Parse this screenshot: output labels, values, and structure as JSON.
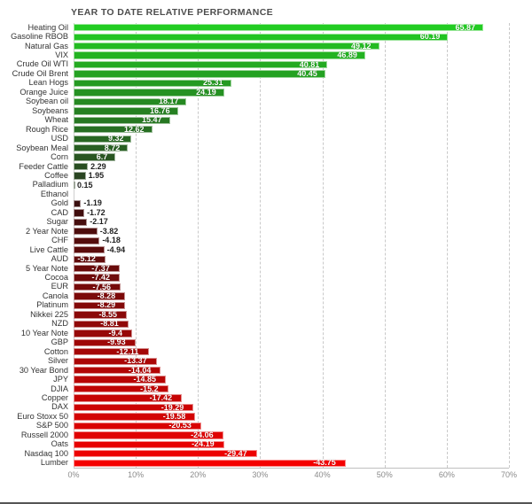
{
  "chart_data": {
    "type": "bar",
    "orientation": "horizontal",
    "title": "YEAR TO DATE RELATIVE PERFORMANCE",
    "xlabel": "",
    "ylabel": "",
    "xlim": [
      0,
      70
    ],
    "xtick_labels": [
      "0%",
      "10%",
      "20%",
      "30%",
      "40%",
      "50%",
      "60%",
      "70%"
    ],
    "xticks": [
      0,
      10,
      20,
      30,
      40,
      50,
      60,
      70
    ],
    "grid": true,
    "legend": "none",
    "note": "Bar length encodes absolute magnitude of the percent change; sign is shown by the label and by bar color (green = positive, red = negative).",
    "categories": [
      "Heating Oil",
      "Gasoline RBOB",
      "Natural Gas",
      "VIX",
      "Crude Oil WTI",
      "Crude Oil Brent",
      "Lean Hogs",
      "Orange Juice",
      "Soybean oil",
      "Soybeans",
      "Wheat",
      "Rough Rice",
      "USD",
      "Soybean Meal",
      "Corn",
      "Feeder Cattle",
      "Coffee",
      "Palladium",
      "Ethanol",
      "Gold",
      "CAD",
      "Sugar",
      "2 Year Note",
      "CHF",
      "Live Cattle",
      "AUD",
      "5 Year Note",
      "Cocoa",
      "EUR",
      "Canola",
      "Platinum",
      "Nikkei 225",
      "NZD",
      "10 Year Note",
      "GBP",
      "Cotton",
      "Silver",
      "30 Year Bond",
      "JPY",
      "DJIA",
      "Copper",
      "DAX",
      "Euro Stoxx 50",
      "S&P 500",
      "Russell 2000",
      "Oats",
      "Nasdaq 100",
      "Lumber"
    ],
    "values": [
      65.87,
      60.19,
      49.12,
      46.89,
      40.81,
      40.45,
      25.31,
      24.19,
      18.17,
      16.76,
      15.47,
      12.62,
      9.32,
      8.72,
      6.7,
      2.29,
      1.95,
      0.15,
      0,
      -1.19,
      -1.72,
      -2.17,
      -3.82,
      -4.18,
      -4.94,
      -5.12,
      -7.37,
      -7.42,
      -7.56,
      -8.28,
      -8.29,
      -8.55,
      -8.81,
      -9.4,
      -9.93,
      -12.11,
      -13.37,
      -14.04,
      -14.85,
      -15.2,
      -17.42,
      -19.29,
      -19.58,
      -20.53,
      -24.06,
      -24.19,
      -29.47,
      -43.75
    ],
    "value_labels": [
      "65.87",
      "60.19",
      "49.12",
      "46.89",
      "40.81",
      "40.45",
      "25.31",
      "24.19",
      "18.17",
      "16.76",
      "15.47",
      "12.62",
      "9.32",
      "8.72",
      "6.7",
      "2.29",
      "1.95",
      "0.15",
      "",
      "-1.19",
      "-1.72",
      "-2.17",
      "-3.82",
      "-4.18",
      "-4.94",
      "-5.12",
      "-7.37",
      "-7.42",
      "-7.56",
      "-8.28",
      "-8.29",
      "-8.55",
      "-8.81",
      "-9.4",
      "-9.93",
      "-12.11",
      "-13.37",
      "-14.04",
      "-14.85",
      "-15.2",
      "-17.42",
      "-19.29",
      "-19.58",
      "-20.53",
      "-24.06",
      "-24.19",
      "-29.47",
      "-43.75"
    ],
    "colors": {
      "positive_bright": "#22cc22",
      "positive_dark": "#2a3d22",
      "negative_dark": "#3a0f0f",
      "negative_bright": "#f40000",
      "gridline": "#c9c9c9",
      "title_text": "#4d4d4d",
      "category_text": "#333333",
      "tick_text": "#8a8a8a",
      "background": "#ffffff"
    }
  }
}
